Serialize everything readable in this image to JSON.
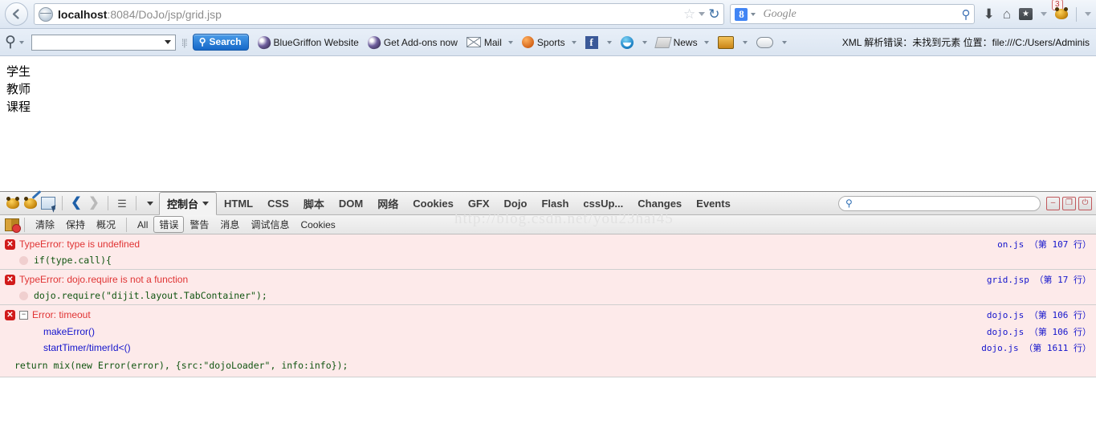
{
  "browser": {
    "back_label": "Back",
    "url_host": "localhost",
    "url_path": ":8084/DoJo/jsp/grid.jsp",
    "url_full": "localhost:8084/DoJo/jsp/grid.jsp",
    "star_glyph": "☆",
    "reload_glyph": "↻",
    "search_engine": "Google",
    "search_engine_initial": "8",
    "search_placeholder": "Google",
    "download_glyph": "⬇",
    "home_glyph": "⌂",
    "bookmark_glyph": "★",
    "addon_badge_count": "3",
    "overflow_caret": "▾"
  },
  "bookmarks_bar": {
    "magnifier_glyph": "⚲",
    "combo_value": "",
    "search_button_label": "Search",
    "search_button_glyph": "⚲",
    "items": [
      {
        "label": "BlueGriffon Website",
        "icon": "bluegriffon-icon",
        "has_caret": false
      },
      {
        "label": "Get Add-ons now",
        "icon": "bluegriffon-icon",
        "has_caret": false
      },
      {
        "label": "Mail",
        "icon": "mail-icon",
        "has_caret": true
      },
      {
        "label": "Sports",
        "icon": "basketball-icon",
        "has_caret": true
      },
      {
        "label": "",
        "icon": "facebook-icon",
        "has_caret": true
      },
      {
        "label": "",
        "icon": "smiley-icon",
        "has_caret": true
      },
      {
        "label": "News",
        "icon": "news-icon",
        "has_caret": true
      },
      {
        "label": "",
        "icon": "monitor-icon",
        "has_caret": true
      },
      {
        "label": "",
        "icon": "gamepad-icon",
        "has_caret": true
      }
    ],
    "status_text": "XML 解析错误：未找到元素 位置：file:///C:/Users/Adminis"
  },
  "page_content": {
    "lines": [
      "学生",
      "教师",
      "课程"
    ]
  },
  "firebug": {
    "toolbar_icons": [
      "firebug-icon",
      "firebug-inspect-icon",
      "inspect-cursor-icon"
    ],
    "nav_back_glyph": "❮",
    "nav_forward_glyph": "❯",
    "menu_glyph": "≡",
    "menu_caret": "▾",
    "active_tab": "控制台",
    "active_tab_caret": "▾",
    "tabs": [
      "HTML",
      "CSS",
      "脚本",
      "DOM",
      "网络",
      "Cookies",
      "GFX",
      "Dojo",
      "Flash",
      "cssUp...",
      "Changes",
      "Events"
    ],
    "search_placeholder": "",
    "search_glyph": "⚲",
    "window_buttons": [
      "minimize",
      "restore",
      "close"
    ],
    "window_button_glyphs": [
      "–",
      "❐",
      "⏻"
    ]
  },
  "console_bar": {
    "clear_icon": "clear-console-icon",
    "actions": [
      "清除",
      "保持",
      "概况"
    ],
    "filters": [
      {
        "label": "All",
        "selected": false
      },
      {
        "label": "错误",
        "selected": true
      },
      {
        "label": "警告",
        "selected": false
      },
      {
        "label": "消息",
        "selected": false
      },
      {
        "label": "调试信息",
        "selected": false
      },
      {
        "label": "Cookies",
        "selected": false
      }
    ]
  },
  "console_entries": [
    {
      "icon": "error-icon",
      "title": "TypeError: type is undefined",
      "source": "on.js （第 107 行）",
      "code": "if(type.call){",
      "expandable": false
    },
    {
      "icon": "error-icon",
      "title": "TypeError: dojo.require is not a function",
      "source": "grid.jsp （第 17 行）",
      "code": "dojo.require(\"dijit.layout.TabContainer\");",
      "expandable": false
    },
    {
      "icon": "error-icon",
      "title": "Error: timeout",
      "source": "dojo.js （第 106 行）",
      "expandable": true,
      "twisty_glyph": "−",
      "stack": [
        {
          "fn": "makeError()",
          "source": "dojo.js （第 106 行）"
        },
        {
          "fn": "startTimer/timerId<()",
          "source": "dojo.js （第 1611 行）"
        }
      ],
      "code": "return mix(new Error(error), {src:\"dojoLoader\", info:info});"
    }
  ],
  "watermark": {
    "text": "http://blog.csdn.net/you23hai45"
  }
}
